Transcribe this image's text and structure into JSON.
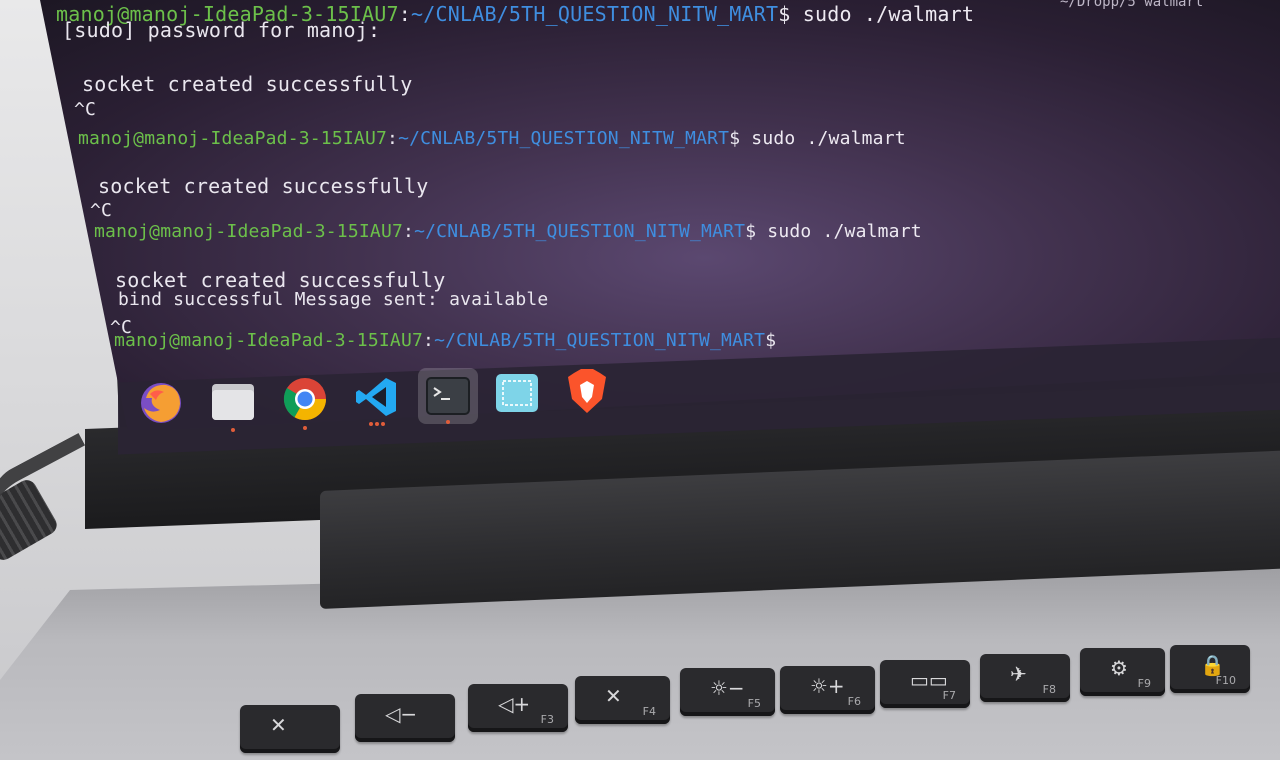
{
  "terminal": {
    "partial_top_prompt": {
      "user": "manoj@manoj-IdeaPad-3-15IAU7",
      "path": "~/CNLAB/5TH_QUESTION_NITW_MART",
      "command": "sudo ./walmart"
    },
    "sudo_prompt": "[sudo] password for manoj:",
    "runs": [
      {
        "output": [
          "socket created successfully"
        ],
        "interrupt": "^C",
        "prompt": {
          "user": "manoj@manoj-IdeaPad-3-15IAU7",
          "path": "~/CNLAB/5TH_QUESTION_NITW_MART",
          "command": "sudo ./walmart"
        }
      },
      {
        "output": [
          "socket created successfully"
        ],
        "interrupt": "^C",
        "prompt": {
          "user": "manoj@manoj-IdeaPad-3-15IAU7",
          "path": "~/CNLAB/5TH_QUESTION_NITW_MART",
          "command": "sudo ./walmart"
        }
      },
      {
        "output": [
          "socket created successfully",
          "bind successful Message sent: available"
        ],
        "interrupt": "^C",
        "prompt": {
          "user": "manoj@manoj-IdeaPad-3-15IAU7",
          "path": "~/CNLAB/5TH_QUESTION_NITW_MART",
          "command": ""
        }
      }
    ],
    "top_right_fragment": "~/Dropp/5 walmart",
    "colors": {
      "user": "#6cc04a",
      "path": "#3f8ee0",
      "text": "#e9e6ee",
      "background": "#42324f"
    }
  },
  "dock": {
    "items": [
      {
        "name": "firefox",
        "icon": "firefox-icon",
        "running": false
      },
      {
        "name": "files",
        "icon": "files-icon",
        "running": true
      },
      {
        "name": "chrome",
        "icon": "chrome-icon",
        "running": true
      },
      {
        "name": "vscode",
        "icon": "vscode-icon",
        "running": true
      },
      {
        "name": "terminal",
        "icon": "terminal-icon",
        "running": true
      },
      {
        "name": "screenshot",
        "icon": "screenshot-icon",
        "running": false
      },
      {
        "name": "brave",
        "icon": "brave-icon",
        "running": false
      }
    ]
  },
  "keyboard": {
    "function_keys": [
      {
        "glyph": "✕",
        "label": ""
      },
      {
        "glyph": "◁−",
        "label": ""
      },
      {
        "glyph": "◁+",
        "label": "F3"
      },
      {
        "glyph": "✕",
        "label": "F4"
      },
      {
        "glyph": "☼−",
        "label": "F5"
      },
      {
        "glyph": "☼+",
        "label": "F6"
      },
      {
        "glyph": "▭▭",
        "label": "F7"
      },
      {
        "glyph": "✈",
        "label": "F8"
      },
      {
        "glyph": "⚙",
        "label": "F9"
      },
      {
        "glyph": "🔒",
        "label": "F10"
      }
    ]
  }
}
